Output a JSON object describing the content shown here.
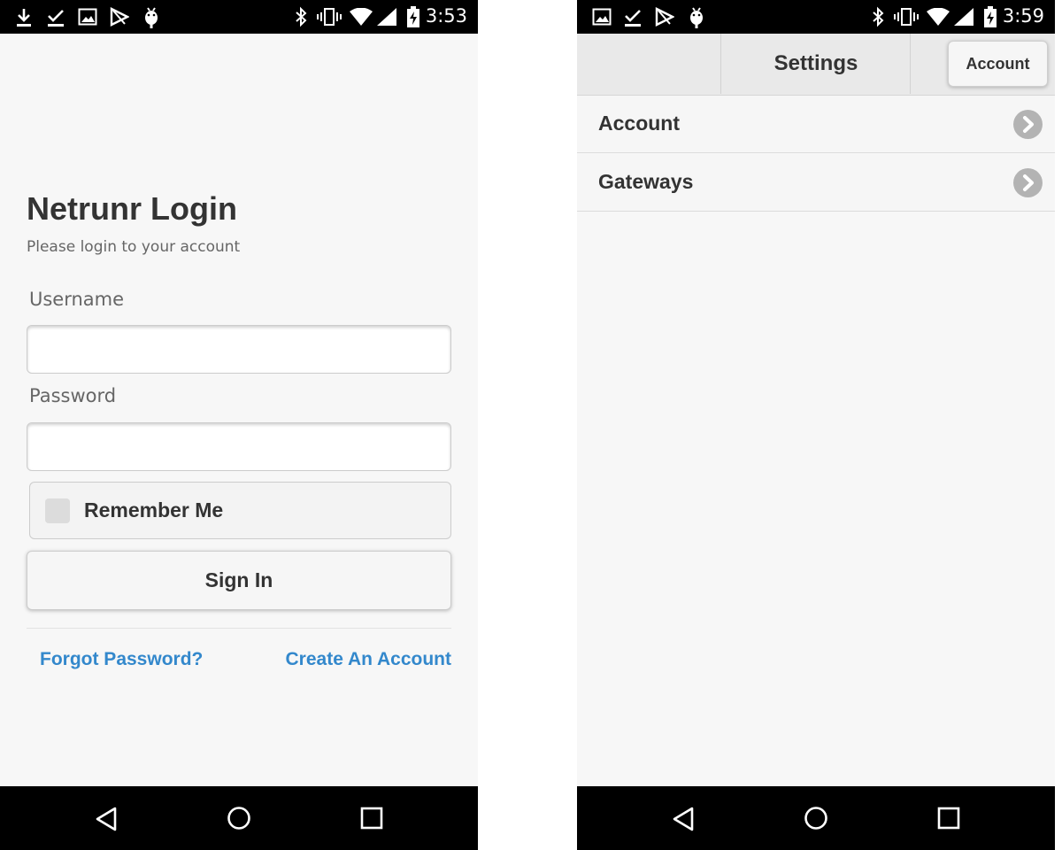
{
  "left_screen": {
    "status_bar": {
      "time": "3:53"
    },
    "login": {
      "title": "Netrunr Login",
      "subtitle": "Please login to your account",
      "username_label": "Username",
      "username_value": "",
      "password_label": "Password",
      "password_value": "",
      "remember_label": "Remember Me",
      "remember_checked": false,
      "signin_label": "Sign In",
      "forgot_link": "Forgot Password?",
      "create_link": "Create An Account"
    }
  },
  "right_screen": {
    "status_bar": {
      "time": "3:59"
    },
    "header": {
      "title": "Settings",
      "account_button": "Account"
    },
    "list": [
      {
        "label": "Account",
        "icon": "chevron-right-icon"
      },
      {
        "label": "Gateways",
        "icon": "chevron-right-icon"
      }
    ]
  },
  "colors": {
    "link": "#3388cc",
    "bars": "#000000",
    "background": "#f7f7f7"
  }
}
